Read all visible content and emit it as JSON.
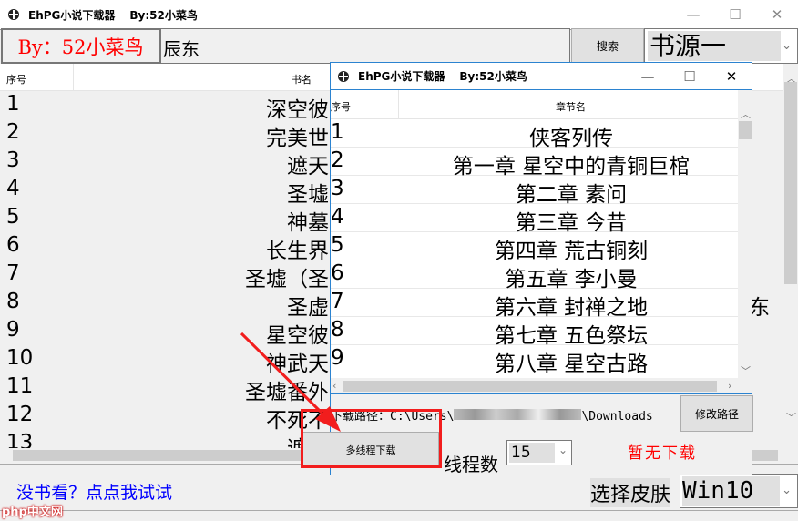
{
  "main": {
    "title": "EhPG小说下载器",
    "author": "By:52小菜鸟",
    "by_label": "By：52小菜鸟",
    "search_value": "辰东",
    "search_button": "搜索",
    "source": "书源一",
    "columns": [
      "序号",
      "书名"
    ],
    "rows": [
      [
        "1",
        "深空彼"
      ],
      [
        "2",
        "完美世"
      ],
      [
        "3",
        "遮天"
      ],
      [
        "4",
        "圣墟"
      ],
      [
        "5",
        "神墓"
      ],
      [
        "6",
        "长生界"
      ],
      [
        "7",
        "圣墟（圣"
      ],
      [
        "8",
        "圣虚"
      ],
      [
        "9",
        "星空彼"
      ],
      [
        "10",
        "神武天"
      ],
      [
        "11",
        "圣墟番外"
      ],
      [
        "12",
        "不死不"
      ],
      [
        "13",
        "遮天"
      ]
    ],
    "author_col_fragment": "东",
    "link": "没书看？点点我试试",
    "skin_label": "选择皮肤",
    "skin": "Win10"
  },
  "child": {
    "title": "EhPG小说下载器",
    "author": "By:52小菜鸟",
    "columns": [
      "序号",
      "章节名"
    ],
    "rows": [
      [
        "1",
        "侠客列传"
      ],
      [
        "2",
        "第一章  星空中的青铜巨棺"
      ],
      [
        "3",
        "第二章  素问"
      ],
      [
        "4",
        "第三章  今昔"
      ],
      [
        "5",
        "第四章  荒古铜刻"
      ],
      [
        "6",
        "第五章  李小曼"
      ],
      [
        "7",
        "第六章  封禅之地"
      ],
      [
        "8",
        "第七章  五色祭坛"
      ],
      [
        "9",
        "第八章  星空古路"
      ]
    ],
    "path_label": "下载路径：C:\\Users\\",
    "path_suffix": "\\Downloads",
    "change_path": "修改路径",
    "download_button": "多线程下载",
    "threads_label": "线程数",
    "threads": "15",
    "status": "暂无下载"
  },
  "watermark": "php中文网",
  "colors": {
    "red": "#ff0000",
    "accent": "#0078d7",
    "link": "#0000ff"
  }
}
